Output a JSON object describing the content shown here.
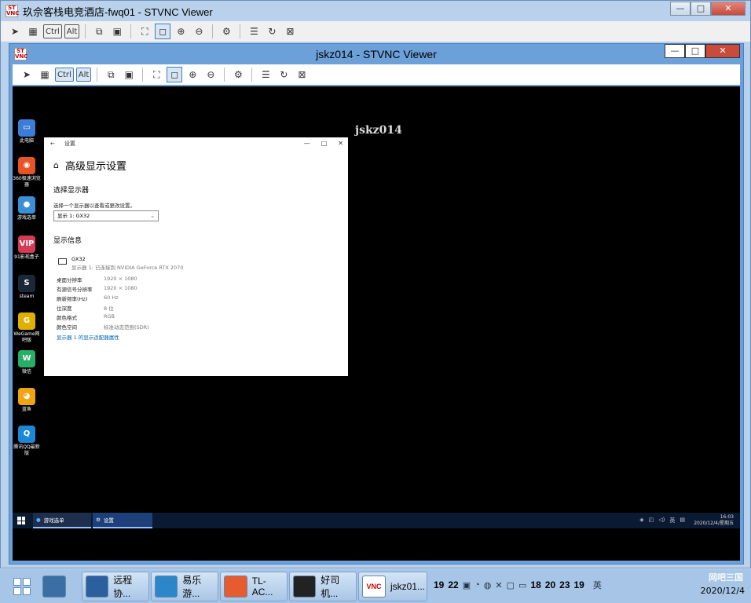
{
  "outer_window": {
    "title": "玖佘客栈电竞酒店-fwq01 - STVNC Viewer",
    "buttons": {
      "minimize": "—",
      "maximize": "□",
      "close": "✕"
    },
    "toolbar": {
      "ctrl": "Ctrl",
      "alt": "Alt"
    }
  },
  "inner_window": {
    "title": "jskz014 - STVNC Viewer",
    "buttons": {
      "minimize": "—",
      "maximize": "□",
      "close": "✕"
    },
    "toolbar": {
      "ctrl": "Ctrl",
      "alt": "Alt"
    }
  },
  "remote": {
    "host_label": "jskz014",
    "desktop_icons": [
      {
        "label": "此电脑",
        "icon": "computer-icon",
        "color": "#3b7dd8",
        "glyph": "▭"
      },
      {
        "label": "360极速浏览器",
        "icon": "browser-360-icon",
        "color": "#e8542a",
        "glyph": "◉"
      },
      {
        "label": "游戏选单",
        "icon": "game-menu-icon",
        "color": "#3a8fd6",
        "glyph": "●"
      },
      {
        "label": "91影视盒子",
        "icon": "video-box-icon",
        "color": "#d63b55",
        "glyph": "VIP"
      },
      {
        "label": "steam",
        "icon": "steam-icon",
        "color": "#1b2838",
        "glyph": "S"
      },
      {
        "label": "WeGame网吧版",
        "icon": "wegame-icon",
        "color": "#e0b000",
        "glyph": "G"
      },
      {
        "label": "微信",
        "icon": "wechat-icon",
        "color": "#2aae67",
        "glyph": "W"
      },
      {
        "label": "蓝鱼",
        "icon": "bluefish-icon",
        "color": "#f1a413",
        "glyph": "◕"
      },
      {
        "label": "腾讯QQ最新版",
        "icon": "qq-icon",
        "color": "#1e86d6",
        "glyph": "Q"
      }
    ],
    "settings": {
      "window_title": "设置",
      "back": "←",
      "controls": {
        "minimize": "—",
        "maximize": "□",
        "close": "✕"
      },
      "heading": "高级显示设置",
      "select_section": "选择显示器",
      "select_hint": "选择一个显示器以查看或更改设置。",
      "select_value": "显示 1: GX32",
      "info_section": "显示信息",
      "monitor_name": "GX32",
      "monitor_desc": "显示器 1: 已连接到 NVIDIA GeForce RTX 2070",
      "info": [
        {
          "k": "桌面分辨率",
          "v": "1920 × 1080"
        },
        {
          "k": "有源信号分辨率",
          "v": "1920 × 1080"
        },
        {
          "k": "刷新频率(Hz)",
          "v": "60 Hz"
        },
        {
          "k": "位深度",
          "v": "8 位"
        },
        {
          "k": "颜色格式",
          "v": "RGB"
        },
        {
          "k": "颜色空间",
          "v": "标准动态范围(SDR)"
        }
      ],
      "adapter_link": "显示器 1 的显示适配器属性"
    },
    "taskbar": {
      "items": [
        {
          "label": "游戏选单"
        },
        {
          "label": "设置"
        }
      ],
      "tray": "英",
      "time": "16:03",
      "date": "2020/12/4/星期五"
    }
  },
  "host_taskbar": {
    "buttons": [
      {
        "label": "",
        "icon": "server-manager-icon",
        "color": "#3b6ea5"
      },
      {
        "label": "远程协...",
        "icon": "remote-desktop-icon",
        "color": "#2b5f9e"
      },
      {
        "label": "易乐游...",
        "icon": "yileyou-icon",
        "color": "#2d86c9"
      },
      {
        "label": "TL-AC...",
        "icon": "browser-icon",
        "color": "#e65c2e"
      },
      {
        "label": "好司机...",
        "icon": "driver-icon",
        "color": "#222222"
      },
      {
        "label": "jskz01...",
        "icon": "stvnc-icon",
        "color": "#ffffff"
      }
    ],
    "tray_numbers": [
      "19",
      "22",
      "18",
      "20",
      "23",
      "19"
    ],
    "ime": "英",
    "date": "2020/12/4",
    "brand": "网吧三国"
  }
}
